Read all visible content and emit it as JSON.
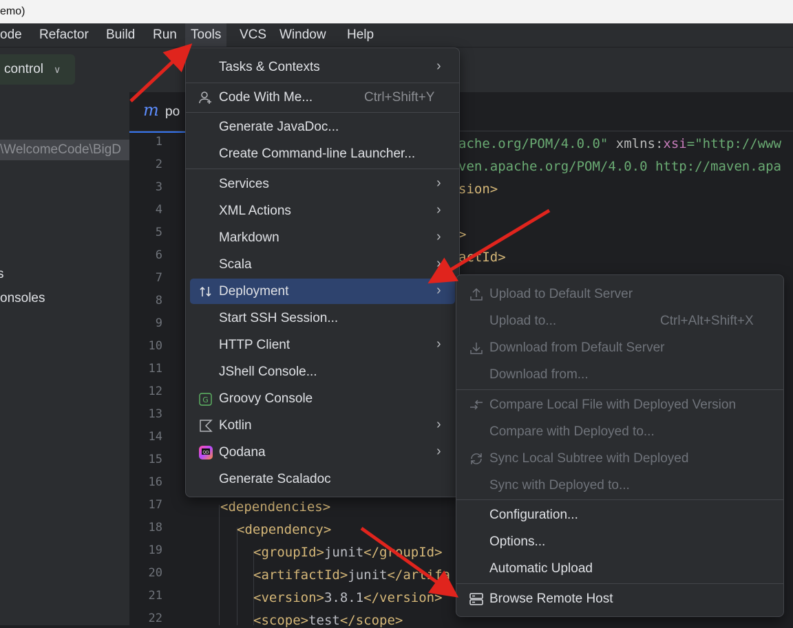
{
  "title": {
    "text": "emo)"
  },
  "menubar": {
    "items": [
      {
        "label": "ode"
      },
      {
        "label": "Refactor"
      },
      {
        "label": "Build"
      },
      {
        "label": "Run"
      },
      {
        "label": "Tools"
      },
      {
        "label": "VCS"
      },
      {
        "label": "Window"
      },
      {
        "label": "Help"
      }
    ]
  },
  "toolbar": {
    "vc_label": "control"
  },
  "sidebar": {
    "path": "\\WelcomeCode\\BigD",
    "item_s": "s",
    "item_consoles": "onsoles"
  },
  "editor": {
    "tab_label": "po",
    "line_numbers": [
      "1",
      "2",
      "3",
      "4",
      "5",
      "6",
      "7",
      "8",
      "9",
      "10",
      "11",
      "12",
      "13",
      "14",
      "15",
      "16",
      "17",
      "18",
      "19",
      "20",
      "21",
      "22"
    ],
    "code": {
      "l1a": "ache.org/POM/4.0.0\"",
      "l1b": " xmlns:",
      "l1c": "xsi",
      "l1d": "=\"http://www",
      "l2": "ven.apache.org/POM/4.0.0 http://maven.apa",
      "l3": "sion>",
      "l5": ">",
      "l6": "actId>",
      "l17": "<dependencies>",
      "l18": "<dependency>",
      "l19a": "<groupId>",
      "l19b": "junit",
      "l19c": "</groupId>",
      "l20a": "<artifactId>",
      "l20b": "junit",
      "l20c": "</artifa",
      "l21a": "<version>",
      "l21b": "3.8.1",
      "l21c": "</version>",
      "l22a": "<scope>",
      "l22b": "test",
      "l22c": "</scope>"
    }
  },
  "tools_menu": {
    "tasks": "Tasks & Contexts",
    "code_with_me": "Code With Me...",
    "code_with_me_shortcut": "Ctrl+Shift+Y",
    "javadoc": "Generate JavaDoc...",
    "launcher": "Create Command-line Launcher...",
    "services": "Services",
    "xml": "XML Actions",
    "markdown": "Markdown",
    "scala": "Scala",
    "deployment": "Deployment",
    "ssh": "Start SSH Session...",
    "http": "HTTP Client",
    "jshell": "JShell Console...",
    "groovy": "Groovy Console",
    "kotlin": "Kotlin",
    "qodana": "Qodana",
    "scaladoc": "Generate Scaladoc"
  },
  "deployment_menu": {
    "upload_default": "Upload to Default Server",
    "upload_to": "Upload to...",
    "upload_to_shortcut": "Ctrl+Alt+Shift+X",
    "download_default": "Download from Default Server",
    "download_from": "Download from...",
    "compare_local": "Compare Local File with Deployed Version",
    "compare_with": "Compare with Deployed to...",
    "sync_local": "Sync Local Subtree with Deployed",
    "sync_with": "Sync with Deployed to...",
    "configuration": "Configuration...",
    "options": "Options...",
    "automatic_upload": "Automatic Upload",
    "browse_remote": "Browse Remote Host"
  },
  "colors": {
    "accent": "#3574f0",
    "selection": "#2e436e",
    "annotation_arrow": "#e0241d"
  },
  "icons": [
    "user-plus-icon",
    "swap-arrows-icon",
    "groovy-icon",
    "kotlin-icon",
    "qodana-icon",
    "upload-icon",
    "download-icon",
    "compare-icon",
    "sync-icon",
    "server-icon",
    "chevron-right-icon"
  ]
}
